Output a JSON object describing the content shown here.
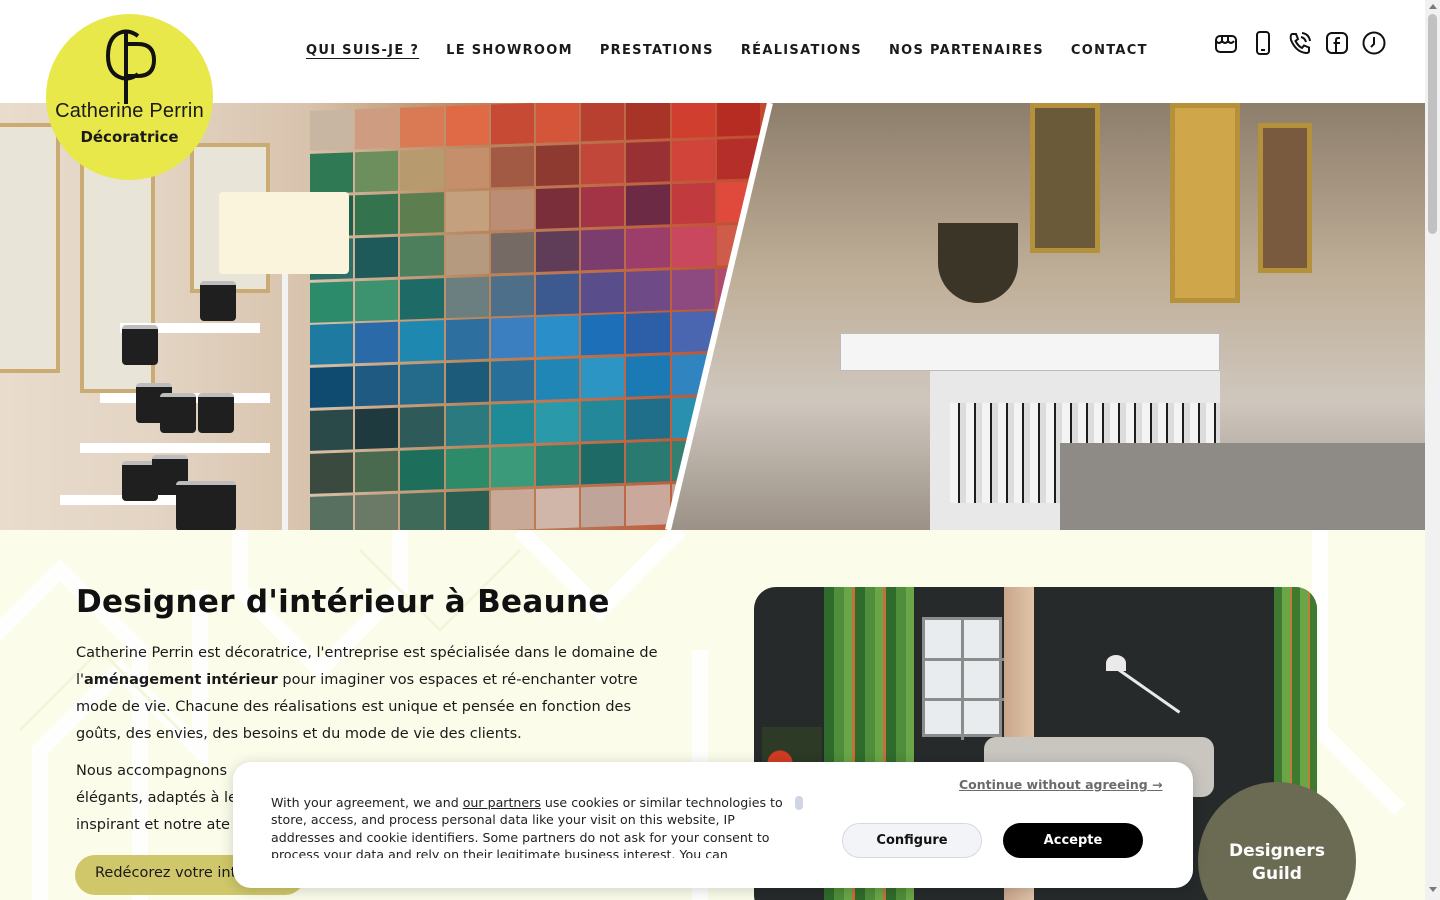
{
  "brand": {
    "name": "Catherine Perrin",
    "subtitle": "Décoratrice",
    "accent_color": "#e9e84a"
  },
  "nav": {
    "items": [
      {
        "label": "QUI SUIS-JE ?",
        "active": true
      },
      {
        "label": "LE SHOWROOM",
        "active": false
      },
      {
        "label": "PRESTATIONS",
        "active": false
      },
      {
        "label": "RÉALISATIONS",
        "active": false
      },
      {
        "label": "NOS PARTENAIRES",
        "active": false
      },
      {
        "label": "CONTACT",
        "active": false
      }
    ]
  },
  "header_icons": [
    "storefront-icon",
    "mobile-phone-icon",
    "phone-call-icon",
    "facebook-icon",
    "clock-icon"
  ],
  "intro": {
    "title": "Designer d'intérieur à Beaune",
    "p1_start": "Catherine Perrin est décoratrice, l'entreprise est spécialisée dans le domaine de l'",
    "p1_bold": "aménagement intérieur",
    "p1_end": " pour imaginer vos espaces et ré-enchanter votre mode de vie. Chacune des réalisations est unique et pensée en fonction des goûts, des envies, des besoins et du mode de vie des clients.",
    "p2_line1": "Nous accompagnons",
    "p2_line2": "élégants, adaptés à le",
    "p2_line3": "inspirant et notre ate",
    "cta_label": "Redécorez votre intérieur"
  },
  "badge": {
    "line1": "Designers",
    "line2": "Guild",
    "color": "#6b6b53"
  },
  "cookie": {
    "text_before_link": "With your agreement, we and ",
    "link_text": "our partners",
    "text_after_link": " use cookies or similar technologies to store, access, and process personal data like your visit on this website, IP addresses and cookie identifiers. Some partners do not ask for your consent to process your data and rely on their legitimate business interest. You can",
    "continue_label": "Continue without agreeing →",
    "configure_label": "Configure",
    "accept_label": "Accepte"
  }
}
